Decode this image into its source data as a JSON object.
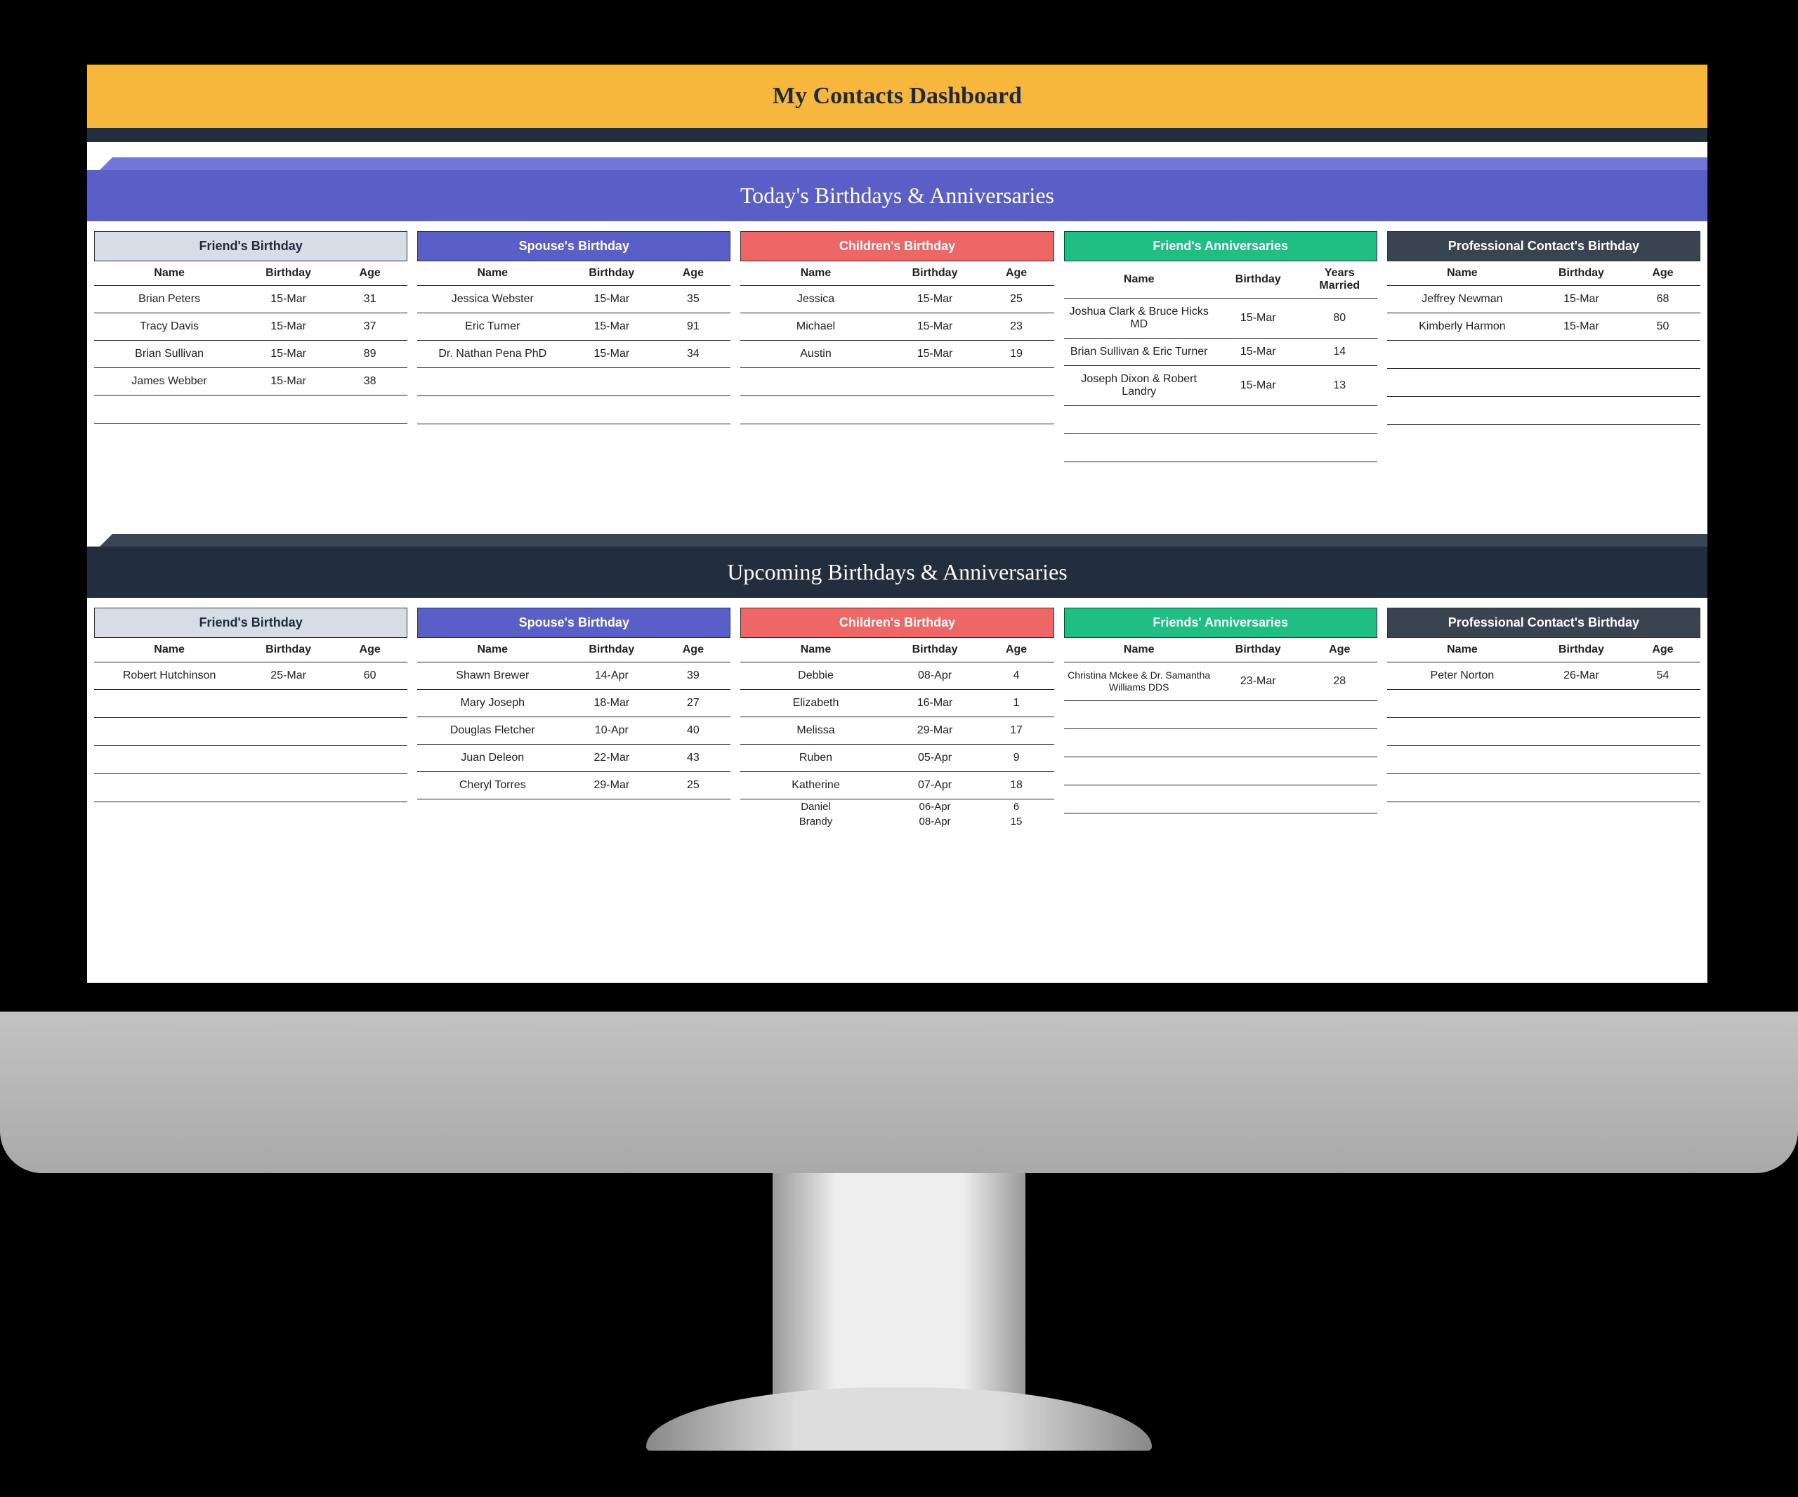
{
  "title": "My Contacts Dashboard",
  "sections": {
    "today": {
      "heading": "Today's Birthdays & Anniversaries"
    },
    "upcoming": {
      "heading": "Upcoming Birthdays & Anniversaries"
    }
  },
  "columns": {
    "name": "Name",
    "birthday": "Birthday",
    "age": "Age",
    "years_married": "Years Married"
  },
  "panel_titles": {
    "friend": "Friend's Birthday",
    "spouse": "Spouse's Birthday",
    "children": "Children's Birthday",
    "anniv_today": "Friend's Anniversaries",
    "anniv_upcoming": "Friends' Anniversaries",
    "prof": "Professional Contact's Birthday"
  },
  "today": {
    "friend": [
      {
        "name": "Brian Peters",
        "date": "15-Mar",
        "val": "31"
      },
      {
        "name": "Tracy Davis",
        "date": "15-Mar",
        "val": "37"
      },
      {
        "name": "Brian Sullivan",
        "date": "15-Mar",
        "val": "89"
      },
      {
        "name": "James Webber",
        "date": "15-Mar",
        "val": "38"
      }
    ],
    "spouse": [
      {
        "name": "Jessica Webster",
        "date": "15-Mar",
        "val": "35"
      },
      {
        "name": "Eric Turner",
        "date": "15-Mar",
        "val": "91"
      },
      {
        "name": "Dr. Nathan Pena PhD",
        "date": "15-Mar",
        "val": "34"
      }
    ],
    "children": [
      {
        "name": "Jessica",
        "date": "15-Mar",
        "val": "25"
      },
      {
        "name": "Michael",
        "date": "15-Mar",
        "val": "23"
      },
      {
        "name": "Austin",
        "date": "15-Mar",
        "val": "19"
      }
    ],
    "anniv": [
      {
        "name": "Joshua Clark & Bruce Hicks MD",
        "date": "15-Mar",
        "val": "80"
      },
      {
        "name": "Brian Sullivan & Eric Turner",
        "date": "15-Mar",
        "val": "14"
      },
      {
        "name": "Joseph Dixon & Robert Landry",
        "date": "15-Mar",
        "val": "13"
      }
    ],
    "prof": [
      {
        "name": "Jeffrey Newman",
        "date": "15-Mar",
        "val": "68"
      },
      {
        "name": "Kimberly Harmon",
        "date": "15-Mar",
        "val": "50"
      }
    ]
  },
  "upcoming": {
    "friend": [
      {
        "name": "Robert Hutchinson",
        "date": "25-Mar",
        "val": "60"
      }
    ],
    "spouse": [
      {
        "name": "Shawn Brewer",
        "date": "14-Apr",
        "val": "39"
      },
      {
        "name": "Mary Joseph",
        "date": "18-Mar",
        "val": "27"
      },
      {
        "name": "Douglas Fletcher",
        "date": "10-Apr",
        "val": "40"
      },
      {
        "name": "Juan Deleon",
        "date": "22-Mar",
        "val": "43"
      },
      {
        "name": "Cheryl Torres",
        "date": "29-Mar",
        "val": "25"
      }
    ],
    "children": [
      {
        "name": "Debbie",
        "date": "08-Apr",
        "val": "4"
      },
      {
        "name": "Elizabeth",
        "date": "16-Mar",
        "val": "1"
      },
      {
        "name": "Melissa",
        "date": "29-Mar",
        "val": "17"
      },
      {
        "name": "Ruben",
        "date": "05-Apr",
        "val": "9"
      },
      {
        "name": "Katherine",
        "date": "07-Apr",
        "val": "18"
      },
      {
        "name": "Daniel",
        "date": "06-Apr",
        "val": "6"
      },
      {
        "name": "Brandy",
        "date": "08-Apr",
        "val": "15"
      }
    ],
    "anniv": [
      {
        "name": "Christina Mckee & Dr. Samantha Williams DDS",
        "date": "23-Mar",
        "val": "28"
      }
    ],
    "prof": [
      {
        "name": "Peter Norton",
        "date": "26-Mar",
        "val": "54"
      }
    ]
  }
}
